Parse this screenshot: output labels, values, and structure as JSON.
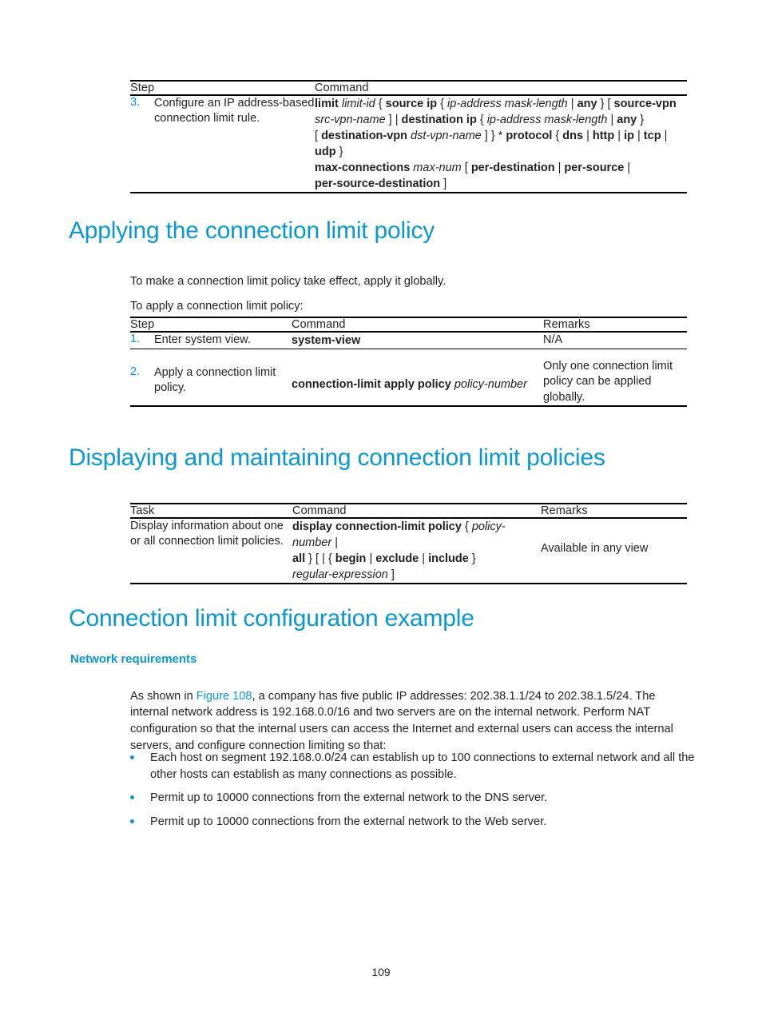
{
  "document": {
    "page_number": "109"
  },
  "table_step3": {
    "headers": {
      "step": "Step",
      "command": "Command"
    },
    "row": {
      "number": "3.",
      "task": "Configure an IP address-based connection limit rule.",
      "command_lines": [
        "limit limit-id { source ip { ip-address mask-length | any } [ source-vpn",
        "src-vpn-name ] | destination ip { ip-address mask-length | any }",
        "[ destination-vpn dst-vpn-name ] } * protocol { dns | http | ip | tcp | udp }",
        "max-connections max-num [ per-destination | per-source |",
        "per-source-destination ]"
      ]
    }
  },
  "section_apply": {
    "heading": "Applying the connection limit policy",
    "para1": "To make a connection limit policy take effect, apply it globally.",
    "para2": "To apply a connection limit policy:",
    "table": {
      "headers": {
        "step": "Step",
        "command": "Command",
        "remarks": "Remarks"
      },
      "rows": [
        {
          "number": "1.",
          "task": "Enter system view.",
          "command": "system-view",
          "remarks": "N/A"
        },
        {
          "number": "2.",
          "task": "Apply a connection limit policy.",
          "command": "connection-limit apply policy policy-number",
          "remarks": "Only one connection limit policy can be applied globally."
        }
      ]
    }
  },
  "section_display": {
    "heading": "Displaying and maintaining connection limit policies",
    "table": {
      "headers": {
        "task": "Task",
        "command": "Command",
        "remarks": "Remarks"
      },
      "rows": [
        {
          "task": "Display information about one or all connection limit policies.",
          "command_lines": [
            "display connection-limit policy { policy-number |",
            "all } [ | { begin | exclude | include }",
            "regular-expression ]"
          ],
          "remarks": "Available in any view"
        }
      ]
    }
  },
  "section_example": {
    "heading": "Connection limit configuration example",
    "subheading": "Network requirements",
    "intro_prefix": "As shown in ",
    "intro_link": "Figure 108",
    "intro_rest": ", a company has five public IP addresses: 202.38.1.1/24 to 202.38.1.5/24. The internal network address is 192.168.0.0/16 and two servers are on the internal network. Perform NAT configuration so that the internal users can access the Internet and external users can access the internal servers, and configure connection limiting so that:",
    "bullets": [
      "Each host on segment 192.168.0.0/24 can establish up to 100 connections to external network and all the other hosts can establish as many connections as possible.",
      "Permit up to 10000 connections from the external network to the DNS server.",
      "Permit up to 10000 connections from the external network to the Web server."
    ]
  },
  "colors": {
    "heading_blue": "#0b97d4",
    "text_black": "#231f20"
  }
}
